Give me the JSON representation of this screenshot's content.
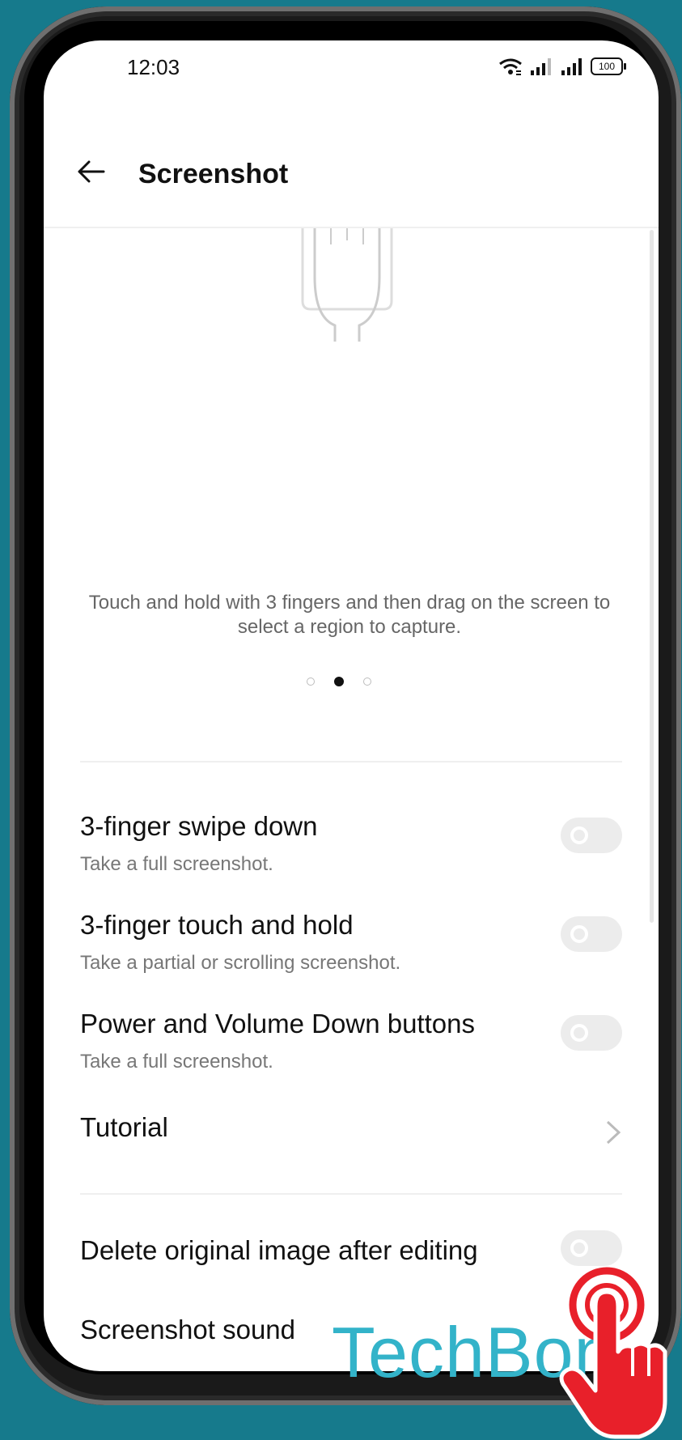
{
  "status_bar": {
    "time": "12:03",
    "battery": "100"
  },
  "header": {
    "title": "Screenshot"
  },
  "gesture_tutorial": {
    "caption": "Touch and hold with 3 fingers and then drag on the screen to select a region to capture.",
    "page_indicator": {
      "pages": 3,
      "active": 2
    }
  },
  "settings": [
    {
      "title": "3-finger swipe down",
      "subtitle": "Take a full screenshot.",
      "toggle": false
    },
    {
      "title": "3-finger touch and hold",
      "subtitle": "Take a partial or scrolling screenshot.",
      "toggle": false
    },
    {
      "title": "Power and Volume Down buttons",
      "subtitle": "Take a full screenshot.",
      "toggle": false
    }
  ],
  "tutorial": {
    "label": "Tutorial"
  },
  "more_settings": [
    {
      "title": "Delete original image after editing",
      "toggle": false
    },
    {
      "title": "Screenshot sound",
      "toggle": false
    }
  ],
  "watermark": "TechBon",
  "icons": [
    "back-arrow-icon",
    "wifi-icon",
    "signal-icon",
    "battery-icon",
    "chevron-right-icon",
    "hand-pointer-icon"
  ]
}
